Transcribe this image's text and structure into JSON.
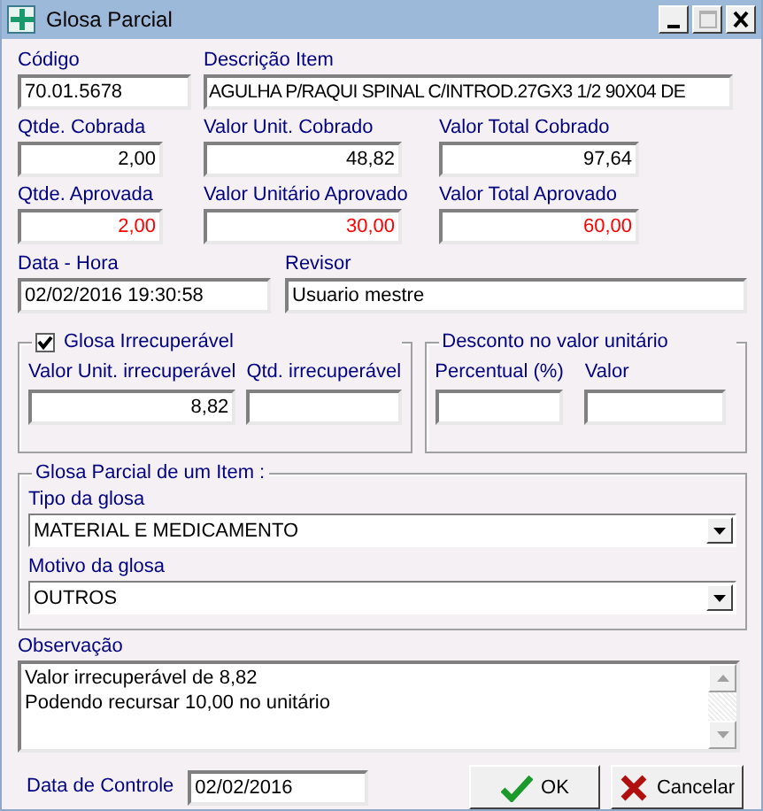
{
  "window": {
    "title": "Glosa Parcial",
    "controls": [
      {
        "kind": "minimize",
        "disabled": false
      },
      {
        "kind": "maximize",
        "disabled": true
      },
      {
        "kind": "close",
        "disabled": false
      }
    ]
  },
  "rows": [
    [
      {
        "label": "Código",
        "value": "70.01.5678",
        "alert": false
      },
      {
        "label": "Descrição Item",
        "value": "AGULHA P/RAQUI SPINAL C/INTROD.27GX3 1/2 90X04 DE",
        "alert": false
      }
    ],
    [
      {
        "label": "Qtde. Cobrada",
        "value": "2,00",
        "alert": false
      },
      {
        "label": "Valor Unit. Cobrado",
        "value": "48,82",
        "alert": false
      },
      {
        "label": "Valor Total Cobrado",
        "value": "97,64",
        "alert": false
      }
    ],
    [
      {
        "label": "Qtde. Aprovada",
        "value": "2,00",
        "alert": true
      },
      {
        "label": "Valor Unitário Aprovado",
        "value": "30,00",
        "alert": true
      },
      {
        "label": "Valor Total Aprovado",
        "value": "60,00",
        "alert": true
      }
    ],
    [
      {
        "label": "Data - Hora",
        "value": "02/02/2016   19:30:58",
        "alert": false
      },
      {
        "label": "Revisor",
        "value": "Usuario mestre",
        "alert": false
      }
    ]
  ],
  "irrecuperavel": {
    "title": "Glosa Irrecuperável",
    "checked": true,
    "fields": [
      {
        "label": "Valor Unit. irrecuperável",
        "value": "8,82"
      },
      {
        "label": "Qtd. irrecuperável"
      }
    ]
  },
  "desconto": {
    "title": "Desconto no valor unitário",
    "fields": [
      {
        "label": "Percentual (%)"
      },
      {
        "label": "Valor"
      }
    ]
  },
  "glosa_item": {
    "title": "Glosa Parcial de um Item :",
    "combos": [
      {
        "label": "Tipo da glosa",
        "value": "MATERIAL E MEDICAMENTO"
      },
      {
        "label": "Motivo da glosa",
        "value": "OUTROS"
      }
    ]
  },
  "observacao": {
    "label": "Observação",
    "lines": [
      "Valor irrecuperável de 8,82",
      "Podendo recursar 10,00 no unitário"
    ]
  },
  "controle": {
    "label": "Data de Controle",
    "value": "02/02/2016"
  },
  "buttons": [
    {
      "label": "OK",
      "kind": "ok"
    },
    {
      "label": "Cancelar",
      "kind": "cancel"
    }
  ]
}
